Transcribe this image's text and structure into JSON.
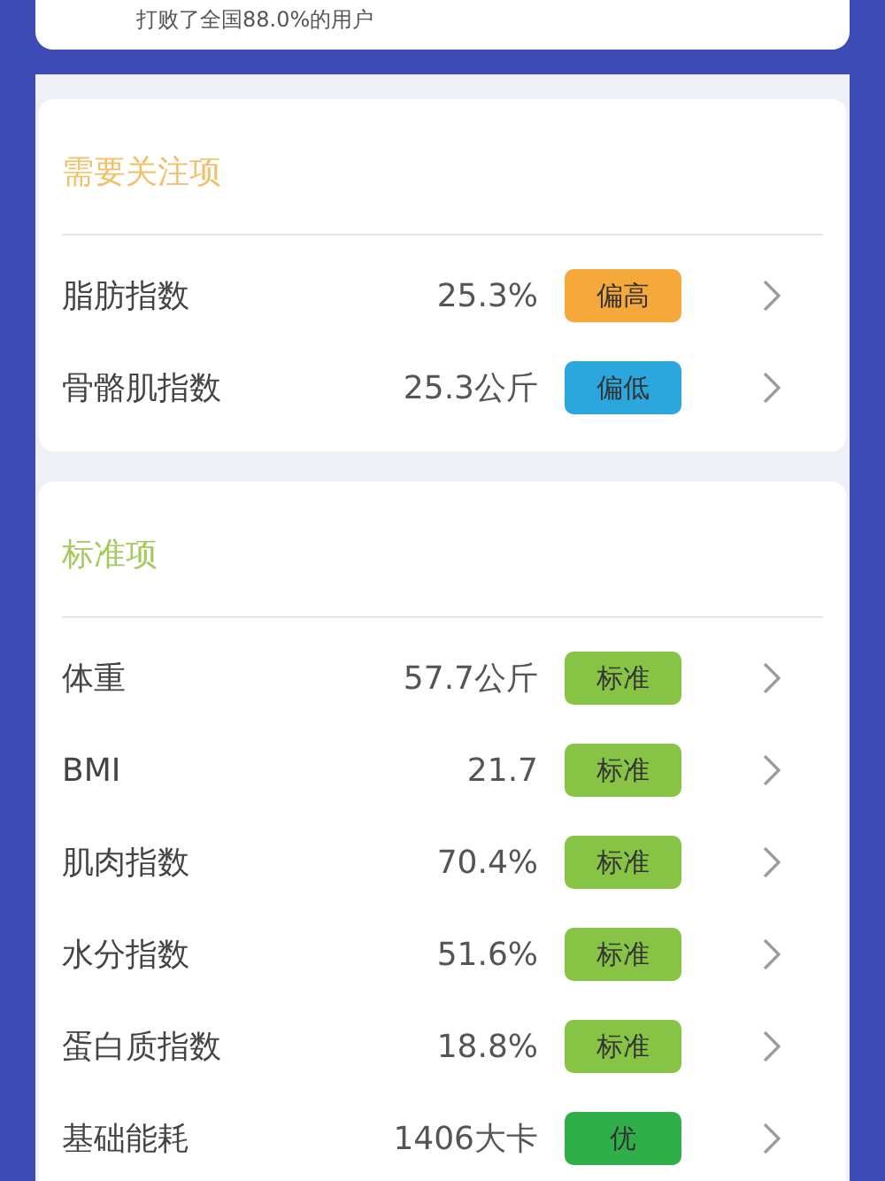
{
  "summary": {
    "text": "打败了全国88.0%的用户"
  },
  "sections": [
    {
      "title": "需要关注项",
      "kind": "attention",
      "items": [
        {
          "name": "脂肪指数",
          "value": "25.3%",
          "badge": "偏高",
          "color": "#f5a93a"
        },
        {
          "name": "骨骼肌指数",
          "value": "25.3公斤",
          "badge": "偏低",
          "color": "#2ba7dd"
        }
      ]
    },
    {
      "title": "标准项",
      "kind": "standard",
      "items": [
        {
          "name": "体重",
          "value": "57.7公斤",
          "badge": "标准",
          "color": "#87c445"
        },
        {
          "name": "BMI",
          "value": "21.7",
          "badge": "标准",
          "color": "#87c445"
        },
        {
          "name": "肌肉指数",
          "value": "70.4%",
          "badge": "标准",
          "color": "#87c445"
        },
        {
          "name": "水分指数",
          "value": "51.6%",
          "badge": "标准",
          "color": "#87c445"
        },
        {
          "name": "蛋白质指数",
          "value": "18.8%",
          "badge": "标准",
          "color": "#87c445"
        },
        {
          "name": "基础能耗",
          "value": "1406大卡",
          "badge": "优",
          "color": "#2fae4a"
        }
      ]
    }
  ]
}
